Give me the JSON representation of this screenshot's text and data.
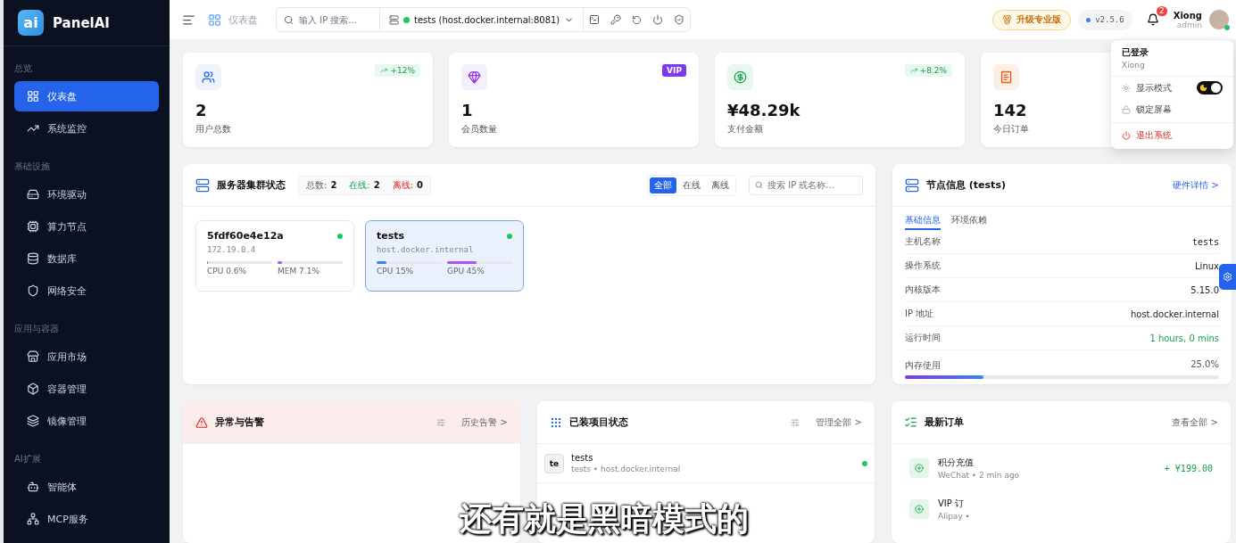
{
  "brand": {
    "mark": "ai",
    "name": "PanelAI"
  },
  "sidebar": {
    "sections": [
      {
        "title": "总览",
        "items": [
          {
            "label": "仪表盘",
            "selected": true
          },
          {
            "label": "系统监控",
            "selected": false
          }
        ]
      },
      {
        "title": "基础设施",
        "items": [
          {
            "label": "环境驱动",
            "selected": false
          },
          {
            "label": "算力节点",
            "selected": false
          },
          {
            "label": "数据库",
            "selected": false
          },
          {
            "label": "网络安全",
            "selected": false
          }
        ]
      },
      {
        "title": "应用与容器",
        "items": [
          {
            "label": "应用市场",
            "selected": false
          },
          {
            "label": "容器管理",
            "selected": false
          },
          {
            "label": "镜像管理",
            "selected": false
          }
        ]
      },
      {
        "title": "AI扩展",
        "items": [
          {
            "label": "智能体",
            "selected": false
          },
          {
            "label": "MCP服务",
            "selected": false
          }
        ]
      }
    ]
  },
  "header": {
    "breadcrumb": "仪表盘",
    "search": {
      "placeholder": "输入 IP 搜索..."
    },
    "server": {
      "label": "tests (host.docker.internal:8081)",
      "online": true
    },
    "upgrade": "升级专业版",
    "version": "v2.5.6",
    "notifications": "2",
    "user": {
      "name": "Xiong",
      "role": "admin",
      "online": true
    }
  },
  "user_menu": {
    "status": "已登录",
    "name": "Xiong",
    "items": [
      {
        "kind": "toggle",
        "label": "显示模式",
        "on": true
      },
      {
        "kind": "plain",
        "label": "锁定屏幕"
      },
      {
        "kind": "danger",
        "label": "退出系统"
      }
    ]
  },
  "stats": [
    {
      "value": "2",
      "label": "用户总数",
      "badge": {
        "kind": "trend",
        "text": "+12%"
      }
    },
    {
      "value": "1",
      "label": "会员数量",
      "badge": {
        "kind": "vip",
        "text": "VIP"
      }
    },
    {
      "value": "¥48.29k",
      "label": "支付金额",
      "badge": {
        "kind": "trend",
        "text": "+8.2%"
      }
    },
    {
      "value": "142",
      "label": "今日订单"
    }
  ],
  "cluster": {
    "title": "服务器集群状态",
    "counts": [
      {
        "kind": "total",
        "label": "总数:",
        "value": "2"
      },
      {
        "kind": "online",
        "label": "在线:",
        "value": "2"
      },
      {
        "kind": "offline",
        "label": "离线:",
        "value": "0"
      }
    ],
    "filters": [
      {
        "label": "全部",
        "selected": true
      },
      {
        "label": "在线",
        "selected": false
      },
      {
        "label": "离线",
        "selected": false
      }
    ],
    "search": {
      "placeholder": "搜索 IP 或名称..."
    },
    "servers": [
      {
        "name": "5fdf60e4e12a",
        "address": "172.19.0.4",
        "online": true,
        "selected": false,
        "meters": [
          {
            "kind": "cpu",
            "label": "CPU 0.6%",
            "level": 0.006
          },
          {
            "kind": "mem",
            "label": "MEM 7.1%",
            "level": 0.071
          }
        ]
      },
      {
        "name": "tests",
        "address": "host.docker.internal",
        "online": true,
        "selected": true,
        "meters": [
          {
            "kind": "cpu",
            "label": "CPU 15%",
            "level": 0.15
          },
          {
            "kind": "gpu",
            "label": "GPU 45%",
            "level": 0.45
          }
        ]
      }
    ]
  },
  "node_info": {
    "title": "节点信息 (tests)",
    "link": "硬件详情 >",
    "tabs": [
      {
        "label": "基础信息",
        "selected": true
      },
      {
        "label": "环境依赖",
        "selected": false
      }
    ],
    "rows": [
      {
        "label": "主机名称",
        "value": "tests",
        "kind": "mono"
      },
      {
        "label": "操作系统",
        "value": "Linux",
        "kind": "plain"
      },
      {
        "label": "内核版本",
        "value": "5.15.0",
        "kind": "plain"
      },
      {
        "label": "IP 地址",
        "value": "host.docker.internal",
        "kind": "plain"
      },
      {
        "label": "运行时间",
        "value": "1 hours, 0 mins",
        "kind": "good"
      }
    ],
    "memory": {
      "label": "内存使用",
      "reading": "25.0%",
      "level": 0.25
    }
  },
  "alerts": {
    "title": "异常与告警",
    "link": "历史告警 >"
  },
  "projects": {
    "title": "已装项目状态",
    "link": "管理全部 >",
    "items": [
      {
        "initials": "te",
        "name": "tests",
        "detail": "tests • host.docker.internal",
        "online": true
      }
    ]
  },
  "orders": {
    "title": "最新订单",
    "link": "查看全部 >",
    "items": [
      {
        "title": "积分充值",
        "detail": "WeChat • 2 min ago",
        "amount": "+ ¥199.00"
      },
      {
        "title": "VIP 订",
        "detail": "Alipay •"
      }
    ]
  },
  "subtitle": "还有就是黑暗模式的"
}
